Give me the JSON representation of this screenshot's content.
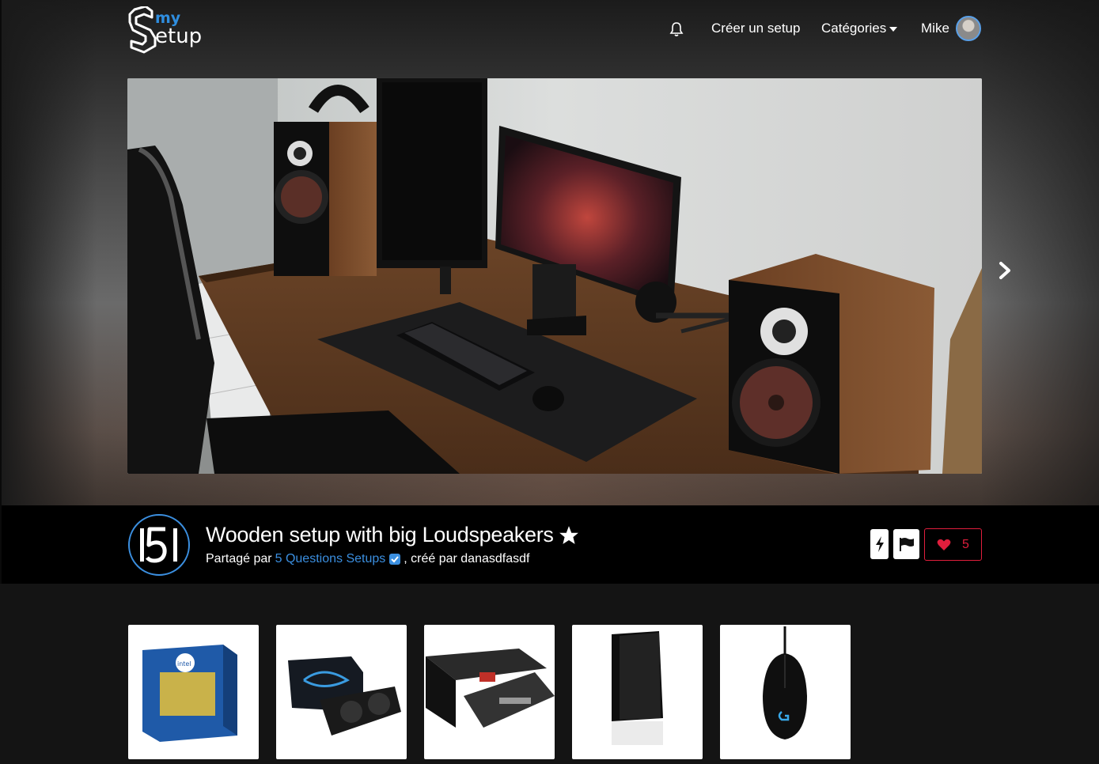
{
  "nav": {
    "create_label": "Créer un setup",
    "categories_label": "Catégories",
    "user_name": "Mike"
  },
  "setup": {
    "title": "Wooden setup with big Loudspeakers",
    "shared_prefix": "Partagé par",
    "shared_by": "5 Questions Setups",
    "created_by": ", créé par danasdfasdf",
    "likes": "5"
  },
  "colors": {
    "accent_blue": "#3b8fe0",
    "like_red": "#e01e3c",
    "background": "#141414"
  },
  "products": [
    {
      "name": "intel-cpu-box"
    },
    {
      "name": "gigabyte-gpu"
    },
    {
      "name": "asrock-motherboard"
    },
    {
      "name": "pc-case"
    },
    {
      "name": "logitech-mouse"
    }
  ]
}
